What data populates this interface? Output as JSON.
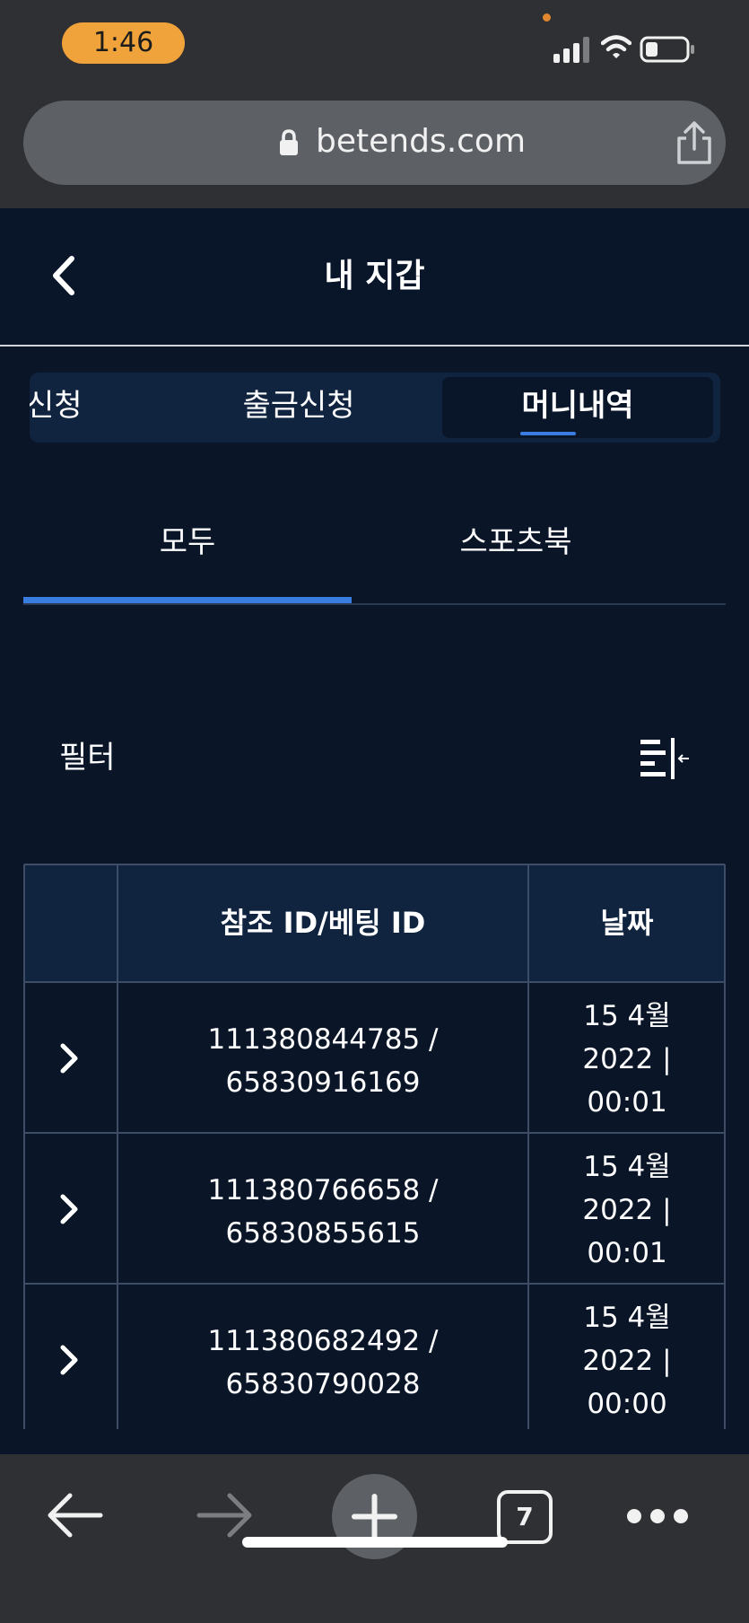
{
  "status_bar": {
    "time": "1:46",
    "icons": [
      "signal-icon",
      "wifi-icon",
      "battery-icon"
    ]
  },
  "browser": {
    "url": "betends.com",
    "icons": [
      "lock-icon",
      "share-icon"
    ]
  },
  "header": {
    "title": "내 지갑",
    "back_icon": "chevron-left-icon"
  },
  "segments": {
    "items": [
      "신청",
      "출금신청",
      "머니내역"
    ],
    "active": "머니내역"
  },
  "subtabs": {
    "items": [
      "모두",
      "스포츠북"
    ],
    "active": "모두"
  },
  "filter": {
    "label": "필터",
    "icon": "filter-collapse-icon"
  },
  "table": {
    "columns": [
      "",
      "참조 ID/베팅 ID",
      "날짜"
    ],
    "rows": [
      {
        "ref_line1": "111380844785 /",
        "ref_line2": "65830916169",
        "date_line1": "15 4월",
        "date_line2": "2022 |",
        "date_line3": "00:01"
      },
      {
        "ref_line1": "111380766658 /",
        "ref_line2": "65830855615",
        "date_line1": "15 4월",
        "date_line2": "2022 |",
        "date_line3": "00:01"
      },
      {
        "ref_line1": "111380682492 /",
        "ref_line2": "65830790028",
        "date_line1": "15 4월",
        "date_line2": "2022 |",
        "date_line3": "00:00"
      }
    ]
  },
  "toolbar": {
    "tab_count": "7",
    "icons": [
      "back-arrow-icon",
      "forward-arrow-icon",
      "plus-icon",
      "tabs-icon",
      "more-icon"
    ]
  },
  "colors": {
    "background": "#0a1628",
    "panel": "#102440",
    "accent": "#3a7de0",
    "time_pill": "#f0a33a",
    "browser_chrome": "#2f3033"
  }
}
